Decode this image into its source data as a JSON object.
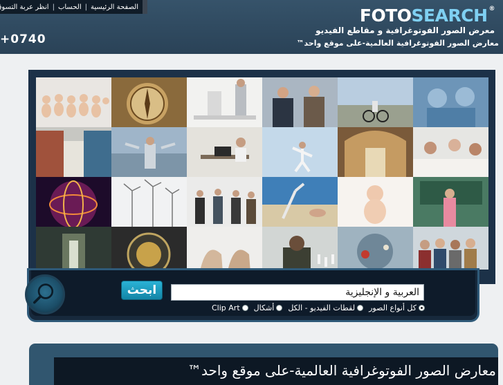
{
  "top_nav": {
    "items": [
      "الصفحة الرئيسية",
      "الحساب",
      "انظر عربة التسوق"
    ]
  },
  "header": {
    "phone": "0740+",
    "logo_part1": "FOTO",
    "logo_part2": "SEARCH",
    "logo_reg": "®",
    "tagline1": "معرض الصور الفوتوغرافية و مقاطع الفيديو",
    "tagline2": "معارض الصور الفوتوغرافية العالمية-على موقع واحد™"
  },
  "search": {
    "input_value": "العربية و الإنجليزية",
    "button_label": "ابحث",
    "options": [
      {
        "label": "كل أنواع الصور",
        "selected": true
      },
      {
        "label": "لقطات الفيديو - الكل",
        "selected": false
      },
      {
        "label": "أشكال",
        "selected": false
      },
      {
        "label": "Clip Art",
        "selected": false
      }
    ]
  },
  "lower": {
    "title": "معارض الصور الفوتوغرافية العالمية-على موقع واحد™"
  },
  "colors": {
    "header_bg": "#36536a",
    "logo_accent": "#7fd0f2",
    "button": "#1f9ec4"
  }
}
